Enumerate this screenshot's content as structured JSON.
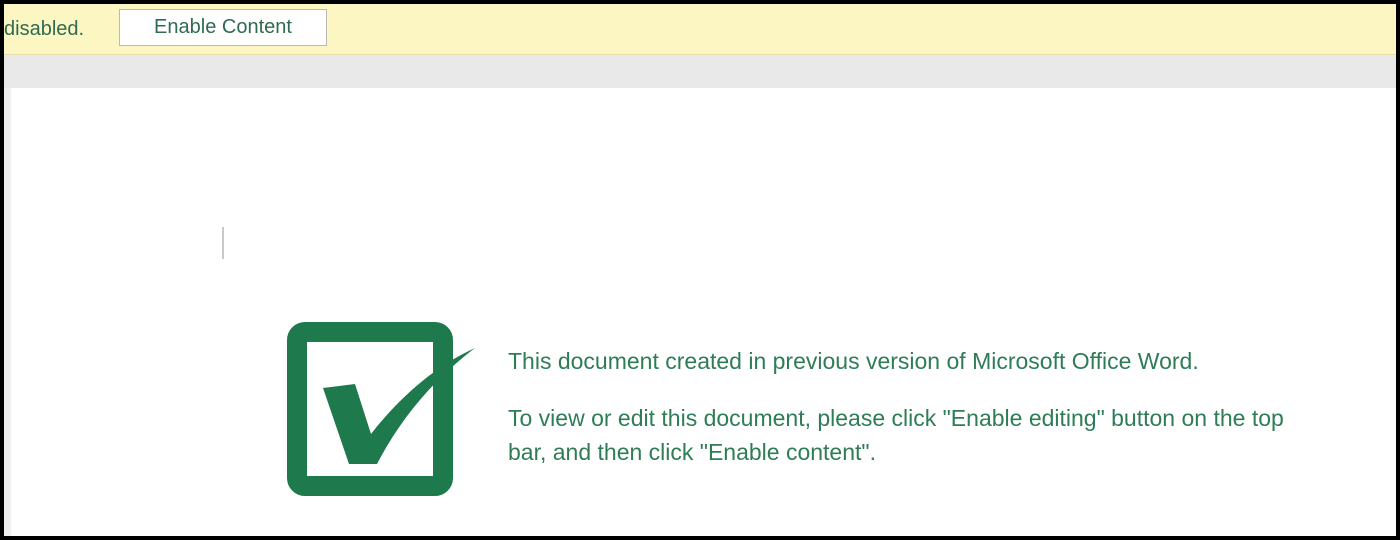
{
  "message_bar": {
    "text": "disabled.",
    "button_label": "Enable Content"
  },
  "document": {
    "heading": "This document created in previous version of Microsoft Office Word.",
    "instruction": "To view or edit this document, please click \"Enable editing\" button on the top bar, and then click \"Enable content\".",
    "logo_icon": "checkbox-checkmark-icon"
  },
  "colors": {
    "message_bar_background": "#fcf6c2",
    "accent_green": "#1e7a4c",
    "text_green": "#2e7d57"
  }
}
